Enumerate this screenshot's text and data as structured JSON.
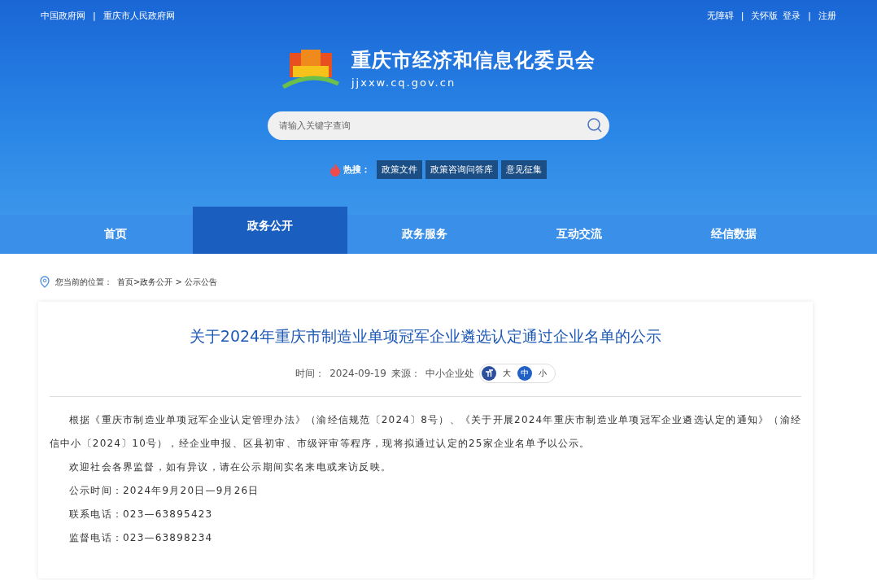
{
  "top_links": {
    "left": [
      {
        "kind": "link",
        "text": "中国政府网"
      },
      {
        "kind": "separator",
        "text": "|"
      },
      {
        "kind": "link",
        "text": "重庆市人民政府网"
      }
    ],
    "right": [
      {
        "kind": "link",
        "text": "无障碍"
      },
      {
        "kind": "separator",
        "text": "|"
      },
      {
        "kind": "link",
        "text": "关怀版"
      },
      {
        "kind": "link",
        "text": "登录"
      },
      {
        "kind": "separator",
        "text": "|"
      },
      {
        "kind": "link",
        "text": "注册"
      }
    ]
  },
  "brand": {
    "name": "重庆市经济和信息化委员会",
    "domain": "jjxxw.cq.gov.cn"
  },
  "search": {
    "placeholder": "请输入关键字查询"
  },
  "hot_search": {
    "label": "热搜：",
    "tags": [
      "政策文件",
      "政策咨询问答库",
      "意见征集"
    ]
  },
  "nav": [
    {
      "label": "首页",
      "selected": false
    },
    {
      "label": "政务公开",
      "selected": true
    },
    {
      "label": "政务服务",
      "selected": false
    },
    {
      "label": "互动交流",
      "selected": false
    },
    {
      "label": "经信数据",
      "selected": false
    }
  ],
  "breadcrumb": {
    "label": "您当前的位置：",
    "path": "首页>政务公开 > 公示公告"
  },
  "article": {
    "title": "关于2024年重庆市制造业单项冠军企业遴选认定通过企业名单的公示",
    "time_label": "时间：",
    "time": "2024-09-19",
    "source_label": "来源：",
    "source": "中小企业处",
    "font_sizes": [
      {
        "label": "大",
        "selected": false
      },
      {
        "label": "中",
        "selected": true
      },
      {
        "label": "小",
        "selected": false
      }
    ],
    "paragraphs": [
      "根据《重庆市制造业单项冠军企业认定管理办法》（渝经信规范〔2024〕8号）、《关于开展2024年重庆市制造业单项冠军企业遴选认定的通知》（渝经信中小〔2024〕10号），经企业申报、区县初审、市级评审等程序，现将拟通过认定的25家企业名单予以公示。",
      "欢迎社会各界监督，如有异议，请在公示期间实名来电或来访反映。",
      "公示时间：2024年9月20日—9月26日",
      "联系电话：023—63895423",
      "监督电话：023—63898234"
    ]
  }
}
